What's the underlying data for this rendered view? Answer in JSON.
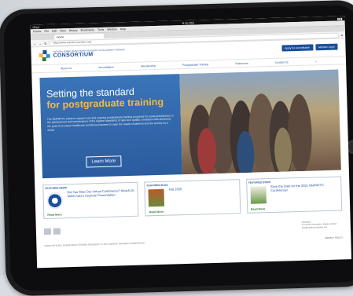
{
  "statusbar": {
    "device": "iPad",
    "time": "6:15 PM"
  },
  "menubar": {
    "items": [
      "Firefox",
      "File",
      "Edit",
      "View",
      "History",
      "Bookmarks",
      "Tools",
      "Window",
      "Help"
    ]
  },
  "browser": {
    "tab_title": "Home",
    "url": "https://www.nnpritcconsortium.org/"
  },
  "site": {
    "logo_small": "NATIONAL NURSE PRACTITIONER RESIDENCY & FELLOWSHIP TRAINING",
    "logo_big": "CONSORTIUM",
    "apply_button": "Apply for Accreditation",
    "member_login": "Member Login",
    "nav": [
      "About Us",
      "Accreditation",
      "Membership",
      "Postgraduate Training",
      "Resources",
      "Contact Us"
    ],
    "hero": {
      "title_line1": "Setting the standard",
      "title_line2": "for postgraduate training",
      "body": "The NNPRFTC exists to support new and ongoing postgraduate training programs for nurse practitioners in the achievement and maintenance of the highest standards of rigor and quality, consistent with achieving the goal of an expert healthcare workforce prepared to meet the needs of patients and the society as a whole.",
      "button": "Learn More"
    },
    "cards": [
      {
        "label": "FEATURED NEWS",
        "text": "Did You Miss Our Virtual Conference? Watch Dr. Mitch Katz's Keynote Presentation.",
        "link": "Read More"
      },
      {
        "label": "FEATURED BLOG",
        "text": "Fall 2020",
        "link": "Read More"
      },
      {
        "label": "FEATURED EVENT",
        "text": "Save the Date for the 2021 NNPRFTC Conference!",
        "link": "Read More"
      }
    ],
    "footer": {
      "copyright": "©2020 NATIONAL NURSE PRACTITIONER RESIDENCY & FELLOWSHIP TRAINING CONSORTIUM",
      "privacy": "PRIVACY POLICY",
      "contact_title": "CONTACT",
      "contact_text": "For further information, please contact:",
      "contact_email": "info@nnpritcconsortium.org"
    }
  },
  "colors": {
    "brand_blue": "#1b4e9b",
    "hero_blue": "#3b74b9",
    "accent_orange": "#f6b84b",
    "link_green": "#2f7d32"
  }
}
